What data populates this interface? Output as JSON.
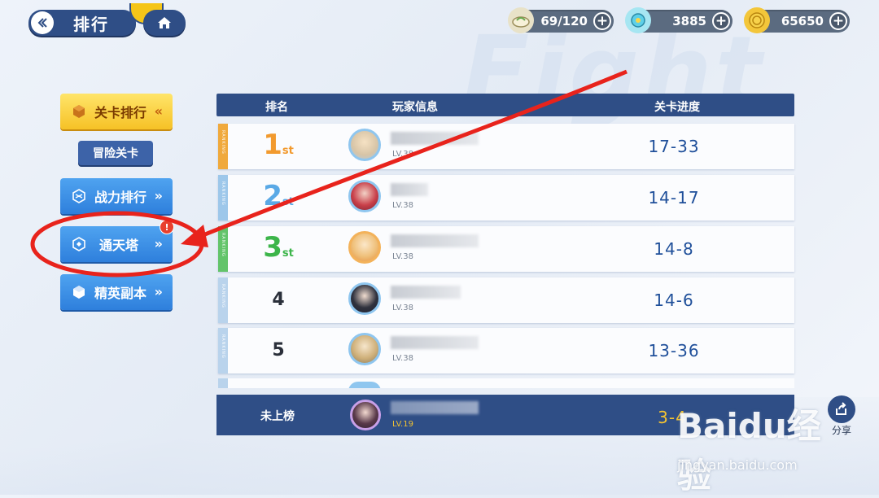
{
  "header": {
    "title": "排行"
  },
  "currencies": [
    {
      "icon": "stamina-bun-icon",
      "value": "69/120"
    },
    {
      "icon": "diamond-orb-icon",
      "value": "3885"
    },
    {
      "icon": "gold-coin-icon",
      "value": "65650"
    }
  ],
  "menu": {
    "level_ranking": "关卡排行",
    "adventure": "冒险关卡",
    "power_ranking": "战力排行",
    "tower": "通天塔",
    "elite_dungeon": "精英副本",
    "tower_alert": "!"
  },
  "table": {
    "headers": {
      "rank": "排名",
      "player": "玩家信息",
      "progress": "关卡进度"
    },
    "rows": [
      {
        "rank": "1",
        "suffix": "st",
        "level": "LV.38",
        "progress": "17-33"
      },
      {
        "rank": "2",
        "suffix": "st",
        "level": "LV.38",
        "progress": "14-17"
      },
      {
        "rank": "3",
        "suffix": "st",
        "level": "LV.38",
        "progress": "14-8"
      },
      {
        "rank": "4",
        "level": "LV.38",
        "progress": "14-6"
      },
      {
        "rank": "5",
        "level": "LV.38",
        "progress": "13-36"
      }
    ],
    "tag_text": "RANKING"
  },
  "self": {
    "label": "未上榜",
    "level": "LV.19",
    "progress": "3-4"
  },
  "share": {
    "label": "分享"
  },
  "watermark": {
    "brand": "Baidu经验",
    "url": "jingyan.baidu.com"
  },
  "colors": {
    "gold": "#f29a2e",
    "silver": "#5aa9e6",
    "bronze": "#3cb54a",
    "navy": "#2f4e86",
    "progress": "#1f4f9a",
    "self_progress": "#f4c331"
  }
}
